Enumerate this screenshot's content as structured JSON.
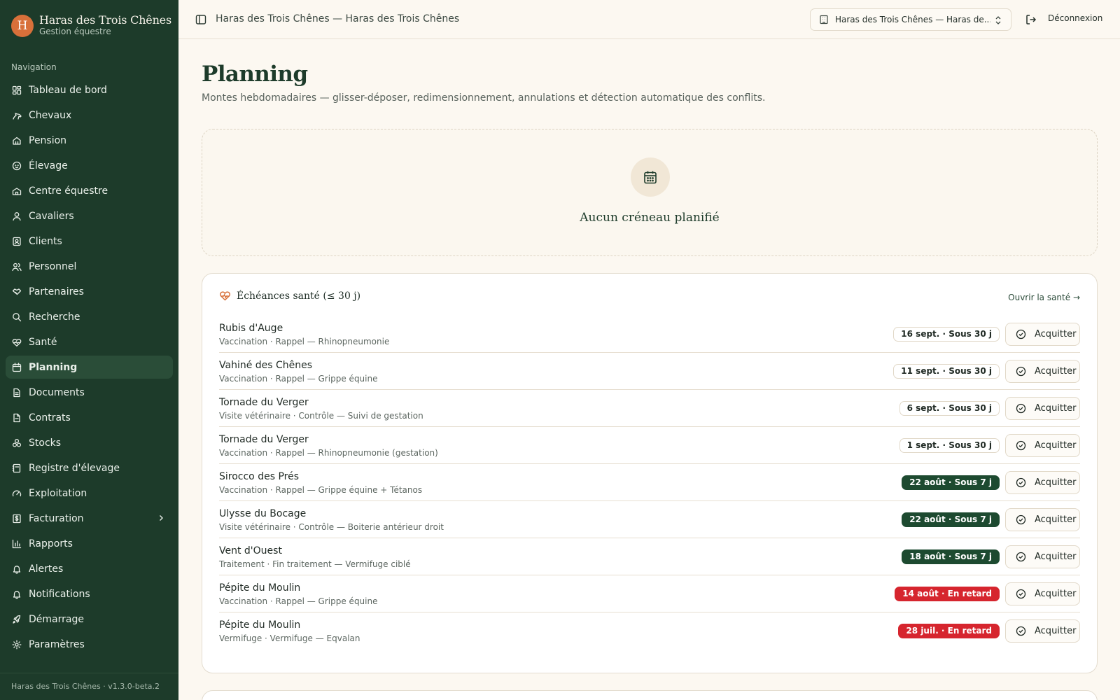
{
  "brand": {
    "initial": "H",
    "name": "Haras des Trois Chênes",
    "subtitle": "Gestion équestre"
  },
  "sidebar": {
    "heading": "Navigation",
    "items": [
      {
        "label": "Tableau de bord",
        "icon": "dashboard-icon"
      },
      {
        "label": "Chevaux",
        "icon": "horse-icon"
      },
      {
        "label": "Pension",
        "icon": "home-icon"
      },
      {
        "label": "Élevage",
        "icon": "baby-icon"
      },
      {
        "label": "Centre équestre",
        "icon": "school-icon"
      },
      {
        "label": "Cavaliers",
        "icon": "user-icon"
      },
      {
        "label": "Clients",
        "icon": "contact-icon"
      },
      {
        "label": "Personnel",
        "icon": "users-icon"
      },
      {
        "label": "Partenaires",
        "icon": "handshake-icon"
      },
      {
        "label": "Recherche",
        "icon": "search-icon"
      },
      {
        "label": "Santé",
        "icon": "heart-pulse-icon"
      },
      {
        "label": "Planning",
        "icon": "calendar-icon",
        "active": true
      },
      {
        "label": "Documents",
        "icon": "file-icon"
      },
      {
        "label": "Contrats",
        "icon": "contract-icon"
      },
      {
        "label": "Stocks",
        "icon": "boxes-icon"
      },
      {
        "label": "Registre d'élevage",
        "icon": "notebook-icon"
      },
      {
        "label": "Exploitation",
        "icon": "gauge-icon"
      },
      {
        "label": "Facturation",
        "icon": "invoice-icon",
        "expandable": true
      },
      {
        "label": "Rapports",
        "icon": "bar-chart-icon"
      },
      {
        "label": "Alertes",
        "icon": "bell-icon"
      },
      {
        "label": "Notifications",
        "icon": "bell-icon"
      },
      {
        "label": "Démarrage",
        "icon": "rocket-icon"
      },
      {
        "label": "Paramètres",
        "icon": "gear-icon"
      }
    ],
    "footer": "Haras des Trois Chênes · v1.3.0-beta.2"
  },
  "topbar": {
    "title": "Haras des Trois Chênes — Haras des Trois Chênes",
    "selector_label": "Haras des Trois Chênes — Haras de...",
    "logout_label": "Déconnexion"
  },
  "main": {
    "title": "Planning",
    "description": "Montes hebdomadaires — glisser-déposer, redimensionnement, annulations et détection automatique des conflits.",
    "empty_label": "Aucun créneau planifié"
  },
  "health": {
    "title": "Échéances santé (≤ 30 j)",
    "link": "Ouvrir la santé →",
    "ack_label": "Acquitter",
    "rows": [
      {
        "name": "Rubis d'Auge",
        "detail": "Vaccination · Rappel — Rhinopneumonie",
        "badge": "16 sept. · Sous 30 j",
        "level": "soon30"
      },
      {
        "name": "Vahiné des Chênes",
        "detail": "Vaccination · Rappel — Grippe équine",
        "badge": "11 sept. · Sous 30 j",
        "level": "soon30"
      },
      {
        "name": "Tornade du Verger",
        "detail": "Visite vétérinaire · Contrôle — Suivi de gestation",
        "badge": "6 sept. · Sous 30 j",
        "level": "soon30"
      },
      {
        "name": "Tornade du Verger",
        "detail": "Vaccination · Rappel — Rhinopneumonie (gestation)",
        "badge": "1 sept. · Sous 30 j",
        "level": "soon30"
      },
      {
        "name": "Sirocco des Prés",
        "detail": "Vaccination · Rappel — Grippe équine + Tétanos",
        "badge": "22 août · Sous 7 j",
        "level": "soon7"
      },
      {
        "name": "Ulysse du Bocage",
        "detail": "Visite vétérinaire · Contrôle — Boiterie antérieur droit",
        "badge": "22 août · Sous 7 j",
        "level": "soon7"
      },
      {
        "name": "Vent d'Ouest",
        "detail": "Traitement · Fin traitement — Vermifuge ciblé",
        "badge": "18 août · Sous 7 j",
        "level": "soon7"
      },
      {
        "name": "Pépite du Moulin",
        "detail": "Vaccination · Rappel — Grippe équine",
        "badge": "14 août · En retard",
        "level": "late"
      },
      {
        "name": "Pépite du Moulin",
        "detail": "Vermifuge · Vermifuge — Eqvalan",
        "badge": "28 juil. · En retard",
        "level": "late"
      }
    ]
  },
  "colors": {
    "sidebar": "#1d3b2a",
    "accent": "#d8703a",
    "late": "#d6252e",
    "soon7": "#1d4a30",
    "background": "#fcf8f1"
  }
}
